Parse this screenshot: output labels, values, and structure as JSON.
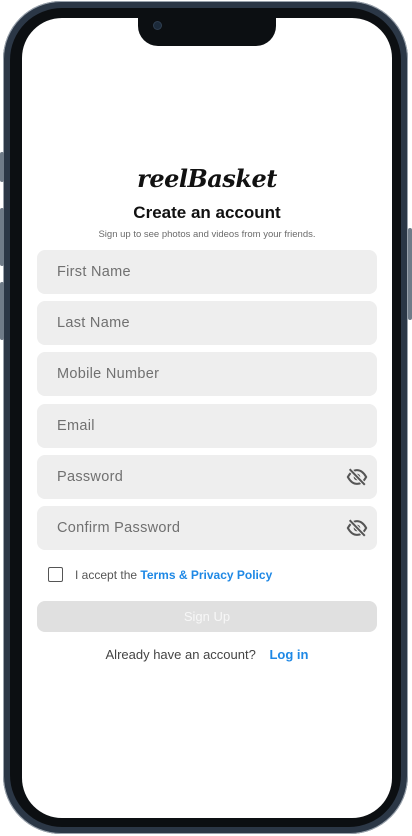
{
  "brand": {
    "name": "reelBasket"
  },
  "header": {
    "title": "Create an account",
    "subtitle": "Sign up to see photos and videos from your friends."
  },
  "form": {
    "first_name": {
      "placeholder": "First Name",
      "value": ""
    },
    "last_name": {
      "placeholder": "Last Name",
      "value": ""
    },
    "mobile": {
      "placeholder": "Mobile Number",
      "value": ""
    },
    "email": {
      "placeholder": "Email",
      "value": ""
    },
    "password": {
      "placeholder": "Password",
      "value": "",
      "visibility_icon": "eye-off-icon"
    },
    "confirm_password": {
      "placeholder": "Confirm Password",
      "value": "",
      "visibility_icon": "eye-off-icon"
    }
  },
  "terms": {
    "checked": false,
    "prefix": "I accept the",
    "link": "Terms & Privacy Policy"
  },
  "signup": {
    "label": "Sign Up",
    "enabled": false
  },
  "login": {
    "prompt": "Already have an account?",
    "link": "Log in"
  },
  "colors": {
    "accent": "#1e88e5",
    "field_bg": "#eeeeee",
    "button_disabled": "#e0e0e0"
  }
}
